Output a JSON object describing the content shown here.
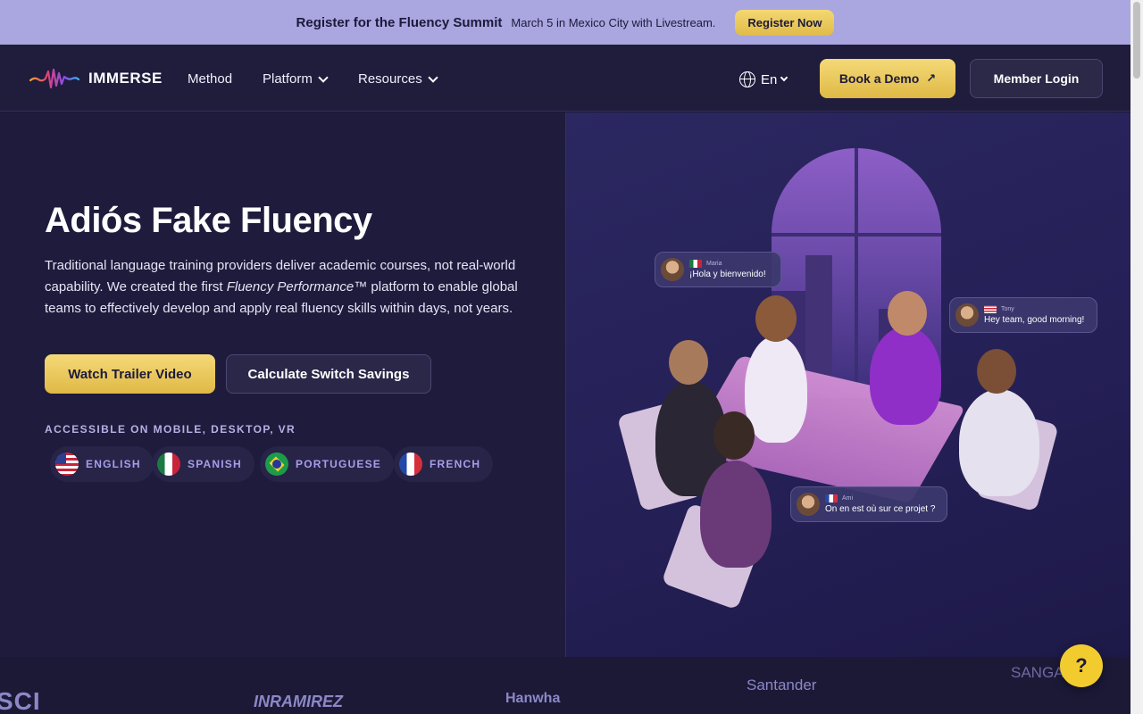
{
  "banner": {
    "title": "Register for the Fluency Summit",
    "subtitle": "March 5 in Mexico City with Livestream.",
    "cta": "Register Now"
  },
  "nav": {
    "logo_text": "IMMERSE",
    "links": [
      {
        "label": "Method"
      },
      {
        "label": "Platform"
      },
      {
        "label": "Resources"
      }
    ],
    "language": "En",
    "demo_label": "Book a Demo",
    "login_label": "Member Login"
  },
  "hero": {
    "title": "Adiós Fake Fluency",
    "desc_part1": "Traditional language training providers deliver academic courses, not real-world capability. We created the first ",
    "desc_em": "Fluency Performance™",
    "desc_part2": " platform to enable global teams to effectively develop and apply real fluency skills within days, not years.",
    "primary_cta": "Watch Trailer Video",
    "secondary_cta": "Calculate Switch Savings",
    "access_label": "ACCESSIBLE ON MOBILE, DESKTOP, VR",
    "languages": [
      "ENGLISH",
      "SPANISH",
      "PORTUGUESE",
      "FRENCH"
    ]
  },
  "chat_bubbles": [
    {
      "name": "Maria",
      "text": "¡Hola y bienvenido!",
      "flag": "mx"
    },
    {
      "name": "Tony",
      "text": "Hey team, good morning!",
      "flag": "us"
    },
    {
      "name": "Ami",
      "text": "On en est où sur ce projet ?",
      "flag": "fr"
    }
  ],
  "client_logos": [
    "SCI",
    "INRAMIREZ",
    "Hanwha",
    "Santander",
    "SANGA"
  ],
  "help_label": "?",
  "colors": {
    "banner_bg": "#a9a6e0",
    "page_bg": "#1b1836",
    "accent_yellow": "#f2cc2e",
    "chip_text": "#a69ee8"
  }
}
